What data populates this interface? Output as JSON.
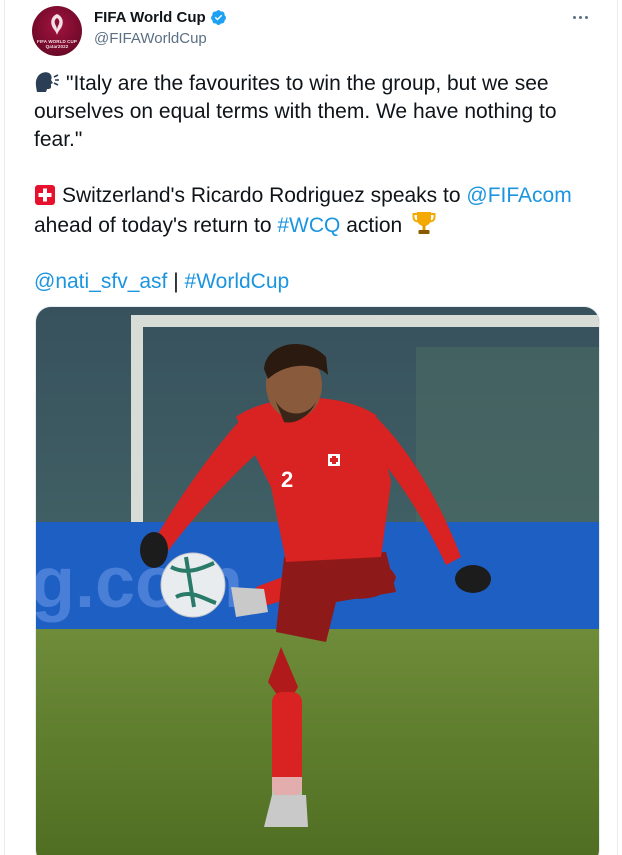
{
  "account": {
    "display_name": "FIFA World Cup",
    "handle": "@FIFAWorldCup",
    "avatar_text": "FIFA WORLD CUP Qatar2022",
    "verified": true
  },
  "tweet": {
    "quote_emoji": "speaking-head-icon",
    "quote": "\"Italy are the favourites to win the group, but we see ourselves on equal terms with them. We have nothing to fear.\"",
    "flag_emoji": "swiss-flag-icon",
    "line2_text1": "Switzerland's Ricardo Rodriguez speaks to",
    "mention_fifacom": "@FIFAcom",
    "line2_text2": "ahead of today's return to",
    "hashtag_wcq": "#WCQ",
    "line2_text3": "action",
    "trophy_emoji": "trophy-icon",
    "mention_nati": "@nati_sfv_asf",
    "separator": "|",
    "hashtag_worldcup": "#WorldCup"
  },
  "photo": {
    "alt_subject": "football-player-photo",
    "shirt_number": "2"
  },
  "colors": {
    "link": "#1b95e0",
    "verified": "#1da1f2",
    "brand": "#7a0c2e",
    "text": "#0f1419",
    "muted": "#5b7083"
  }
}
